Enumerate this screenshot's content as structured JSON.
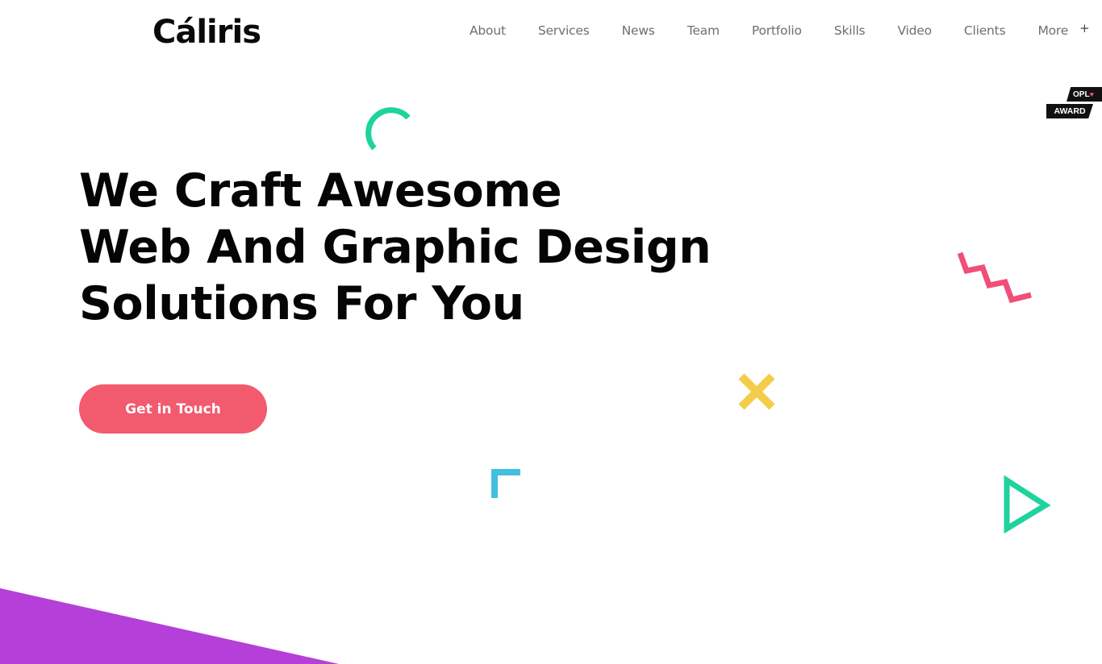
{
  "header": {
    "logo": "Cáliris",
    "nav": [
      {
        "label": "About"
      },
      {
        "label": "Services"
      },
      {
        "label": "News"
      },
      {
        "label": "Team"
      },
      {
        "label": "Portfolio"
      },
      {
        "label": "Skills"
      },
      {
        "label": "Video"
      },
      {
        "label": "Clients"
      },
      {
        "label": "More",
        "icon": "plus-icon",
        "glyph": "+"
      }
    ]
  },
  "award_badge": {
    "top": "OPL",
    "heart_glyph": "♥",
    "bottom": "AWARD"
  },
  "hero": {
    "lines": [
      "We Craft Awesome",
      "Web And Graphic Design",
      "Solutions For You"
    ],
    "cta_label": "Get in Touch"
  },
  "colors": {
    "cta": "#f25a6e",
    "teal": "#1ed39c",
    "pink": "#ef4f78",
    "yellow": "#f3cd4a",
    "blue": "#43bfe0",
    "purple": "#b53fd9"
  }
}
